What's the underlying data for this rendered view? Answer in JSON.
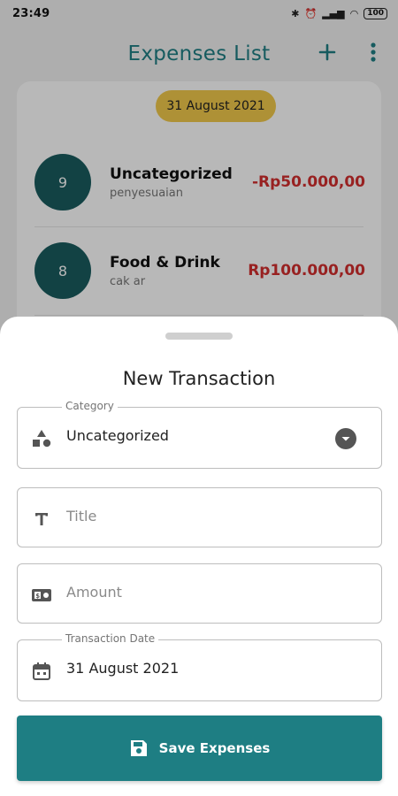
{
  "statusbar": {
    "time": "23:49",
    "battery": "100"
  },
  "appbar": {
    "title": "Expenses List"
  },
  "list": {
    "date_chip": "31 August 2021",
    "transactions": [
      {
        "count": "9",
        "category": "Uncategorized",
        "title": "penyesuaian",
        "amount": "-Rp50.000,00"
      },
      {
        "count": "8",
        "category": "Food & Drink",
        "title": "cak ar",
        "amount": "Rp100.000,00"
      }
    ]
  },
  "sheet": {
    "title": "New Transaction",
    "category": {
      "label": "Category",
      "value": "Uncategorized",
      "icon": "category-shapes-icon"
    },
    "title_field": {
      "placeholder": "Title",
      "icon": "text-t-icon"
    },
    "amount_field": {
      "placeholder": "Amount",
      "icon": "money-icon"
    },
    "date_field": {
      "label": "Transaction Date",
      "value": "31 August 2021",
      "icon": "calendar-icon"
    },
    "save_label": "Save Expenses"
  },
  "colors": {
    "accent": "#1e7e83",
    "chip": "#f2c94c",
    "avatar": "#1a5c5f",
    "amount": "#d32f2f"
  }
}
